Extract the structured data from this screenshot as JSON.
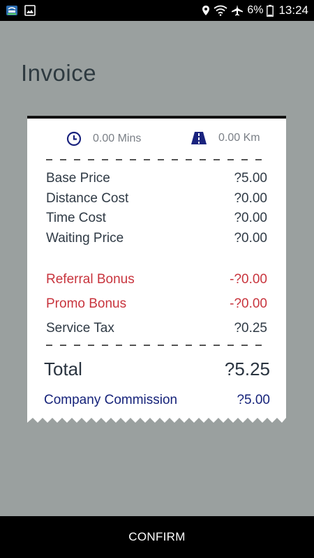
{
  "status_bar": {
    "battery_text": "6%",
    "time": "13:24",
    "icons": [
      "app-notification-icon",
      "image-icon",
      "location-icon",
      "wifi-icon",
      "airplane-icon",
      "battery-icon"
    ]
  },
  "page": {
    "title": "Invoice"
  },
  "trip": {
    "duration": "0.00 Mins",
    "distance": "0.00 Km",
    "duration_icon": "clock-icon",
    "distance_icon": "road-icon"
  },
  "invoice": {
    "rows": [
      {
        "label": "Base Price",
        "value": "?5.00"
      },
      {
        "label": "Distance Cost",
        "value": "?0.00"
      },
      {
        "label": "Time Cost",
        "value": "?0.00"
      },
      {
        "label": "Waiting Price",
        "value": "?0.00"
      }
    ],
    "referral": {
      "label": "Referral Bonus",
      "value": "-?0.00"
    },
    "promo": {
      "label": "Promo Bonus",
      "value": "-?0.00"
    },
    "service_tax": {
      "label": "Service Tax",
      "value": "?0.25"
    },
    "total": {
      "label": "Total",
      "value": "?5.25"
    },
    "commission": {
      "label": "Company Commission",
      "value": "?5.00"
    }
  },
  "colors": {
    "background": "#9aa09f",
    "bonus_red": "#c8343d",
    "commission_navy": "#16237a",
    "icon_navy": "#1a237e"
  },
  "actions": {
    "confirm_label": "CONFIRM"
  }
}
